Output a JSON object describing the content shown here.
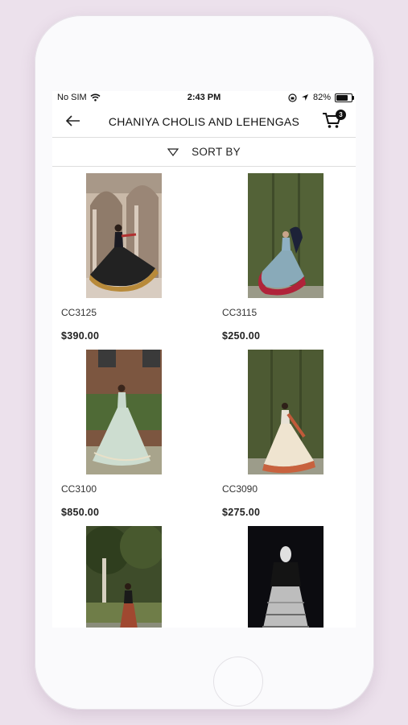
{
  "status": {
    "carrier": "No SIM",
    "time": "2:43 PM",
    "battery": "82%"
  },
  "header": {
    "title": "CHANIYA CHOLIS AND LEHENGAS",
    "cart_count": "3"
  },
  "sort": {
    "label": "SORT BY"
  },
  "products": [
    {
      "code": "CC3125",
      "price": "$390.00"
    },
    {
      "code": "CC3115",
      "price": "$250.00"
    },
    {
      "code": "CC3100",
      "price": "$850.00"
    },
    {
      "code": "CC3090",
      "price": "$275.00"
    },
    {
      "code": "",
      "price": ""
    },
    {
      "code": "",
      "price": ""
    }
  ]
}
